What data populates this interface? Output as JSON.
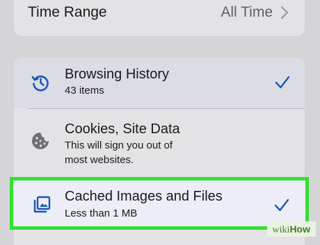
{
  "time_range": {
    "label": "Time Range",
    "value": "All Time"
  },
  "items": [
    {
      "title": "Browsing History",
      "subtitle": "43 items",
      "icon": "history-icon",
      "checked": true
    },
    {
      "title": "Cookies, Site Data",
      "subtitle_line1": "This will sign you out of",
      "subtitle_line2": "most websites.",
      "icon": "cookie-icon",
      "checked": false
    },
    {
      "title": "Cached Images and Files",
      "subtitle": "Less than 1 MB",
      "icon": "images-icon",
      "checked": true
    }
  ],
  "watermark": {
    "wiki": "wiki",
    "how": "How"
  },
  "colors": {
    "accent": "#1c56b4",
    "highlight_border": "#33e030"
  }
}
